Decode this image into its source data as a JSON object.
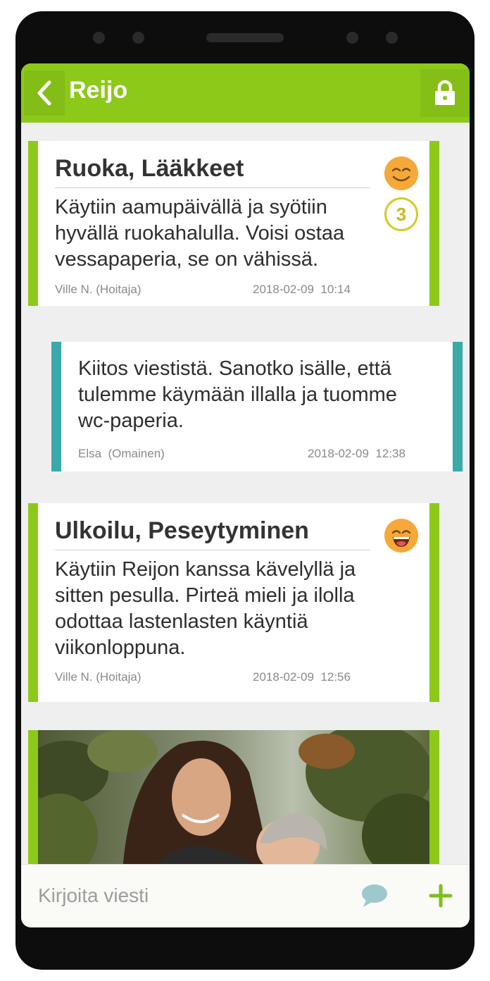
{
  "header": {
    "title": "Reijo",
    "colors": {
      "primary": "#8cc919",
      "secondary": "#3aa9a9"
    }
  },
  "messages": [
    {
      "title": "Ruoka, Lääkkeet",
      "body": "Käytiin aamupäivällä ja syötiin hyvällä ruokahalulla. Voisi ostaa vessapaperia, se on vähissä.",
      "author": "Ville N. (Hoitaja)",
      "timestamp": "2018-02-09  10:14",
      "mood_icon": "smiling-face-icon",
      "badge": "3"
    },
    {
      "body": "Kiitos viestistä. Sanotko isälle, että tulemme käymään illalla ja tuomme wc-paperia.",
      "author": "Elsa  (Omainen)",
      "timestamp": "2018-02-09  12:38"
    },
    {
      "title": "Ulkoilu, Peseytyminen",
      "body": "Käytiin Reijon kanssa kävelyllä ja sitten pesulla. Pirteä mieli ja ilolla odottaa lastenlasten käyntiä viikonloppuna.",
      "author": "Ville N. (Hoitaja)",
      "timestamp": "2018-02-09  12:56",
      "mood_icon": "laughing-face-icon"
    }
  ],
  "composer": {
    "placeholder": "Kirjoita viesti"
  }
}
